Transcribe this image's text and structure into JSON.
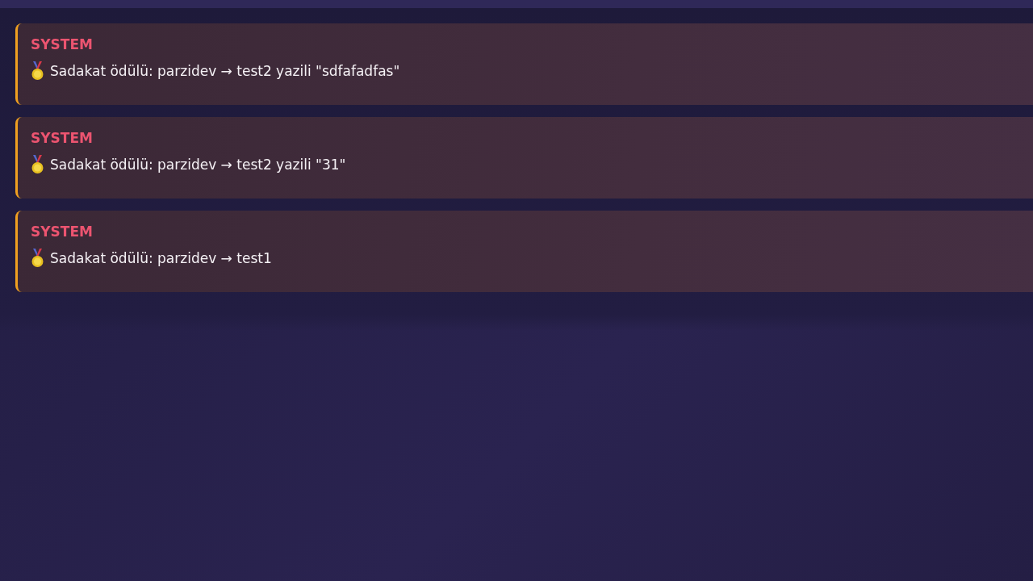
{
  "messages": [
    {
      "sender": "SYSTEM",
      "text": "Sadakat ödülü: parzidev → test2 yazili \"sdfafadfas\""
    },
    {
      "sender": "SYSTEM",
      "text": "Sadakat ödülü: parzidev → test2 yazili \"31\""
    },
    {
      "sender": "SYSTEM",
      "text": "Sadakat ödülü: parzidev → test1"
    }
  ]
}
